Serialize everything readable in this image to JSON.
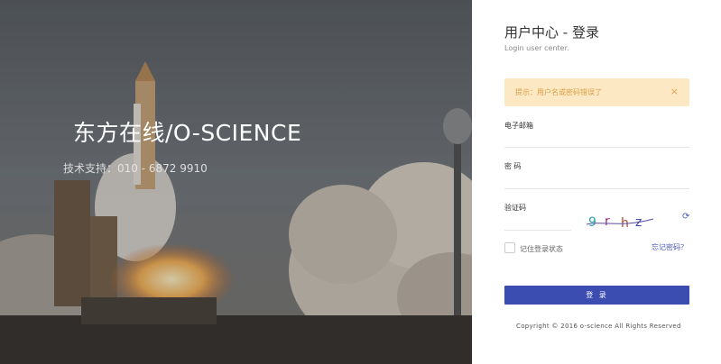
{
  "hero": {
    "title": "东方在线/O-SCIENCE",
    "support": "技术支持：010 - 6872 9910"
  },
  "panel": {
    "title": "用户中心 - 登录",
    "subtitle": "Login user center.",
    "alert": {
      "text": "提示：用户名或密码错误了",
      "close": "×"
    },
    "email_label": "电子邮箱",
    "password_label": "密 码",
    "captcha_label": "验证码",
    "captcha_text": "9 r h z",
    "refresh_icon": "⟳",
    "remember_label": "记住登录状态",
    "forgot_link": "忘记密码？",
    "login_button": "登 录",
    "copyright": "Copyright © 2016 o-science All Rights Reserved"
  },
  "colors": {
    "accent": "#3b4db0",
    "alert_bg": "#fde8c4",
    "alert_text": "#d9a046"
  }
}
